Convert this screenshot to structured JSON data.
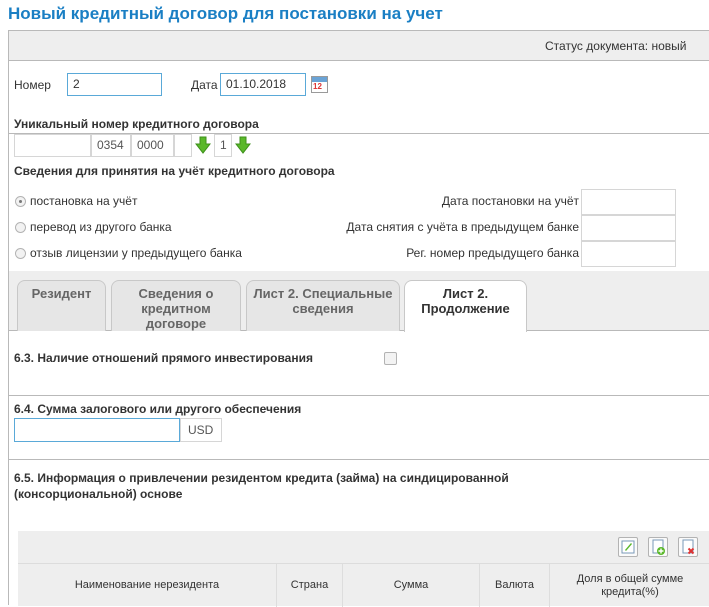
{
  "title": "Новый кредитный договор для постановки на учет",
  "status": {
    "label": "Статус документа: новый"
  },
  "header": {
    "number_label": "Номер",
    "number_value": "2",
    "date_label": "Дата",
    "date_value": "01.10.2018"
  },
  "unique_number": {
    "heading": "Уникальный номер кредитного договора",
    "parts": [
      "",
      "0354",
      "0000",
      "",
      "1"
    ]
  },
  "acceptance": {
    "heading": "Сведения для принятия на учёт кредитного договора",
    "options": [
      {
        "label": "постановка на учёт",
        "selected": true
      },
      {
        "label": "перевод из другого банка",
        "selected": false
      },
      {
        "label": "отзыв лицензии у предыдущего банка",
        "selected": false
      }
    ],
    "fields": [
      {
        "label": "Дата постановки на учёт",
        "value": ""
      },
      {
        "label": "Дата снятия с учёта в предыдущем банке",
        "value": ""
      },
      {
        "label": "Рег. номер предыдущего банка",
        "value": ""
      }
    ]
  },
  "tabs": [
    {
      "label": "Резидент",
      "active": false
    },
    {
      "label": "Сведения о кредитном договоре",
      "active": false
    },
    {
      "label": "Лист 2. Специальные сведения",
      "active": false
    },
    {
      "label": "Лист 2. Продолжение",
      "active": true
    }
  ],
  "section_63": {
    "label": "6.3. Наличие отношений прямого инвестирования",
    "checked": false
  },
  "section_64": {
    "label": "6.4. Сумма залогового или другого обеспечения",
    "value": "",
    "currency": "USD"
  },
  "section_65": {
    "label_line1": "6.5. Информация о привлечении резидентом кредита (займа) на синдицированной",
    "label_line2": "(консорциональной) основе"
  },
  "table": {
    "columns": [
      "Наименование нерезидента",
      "Страна",
      "Сумма",
      "Валюта",
      "Доля в общей сумме кредита(%)"
    ]
  },
  "icons": [
    "calendar-icon",
    "arrow-down-icon",
    "edit-icon",
    "add-icon",
    "delete-icon"
  ],
  "colors": {
    "title": "#1a7fc4",
    "arrow": "#5ab82a",
    "panel": "#eeeeee"
  }
}
